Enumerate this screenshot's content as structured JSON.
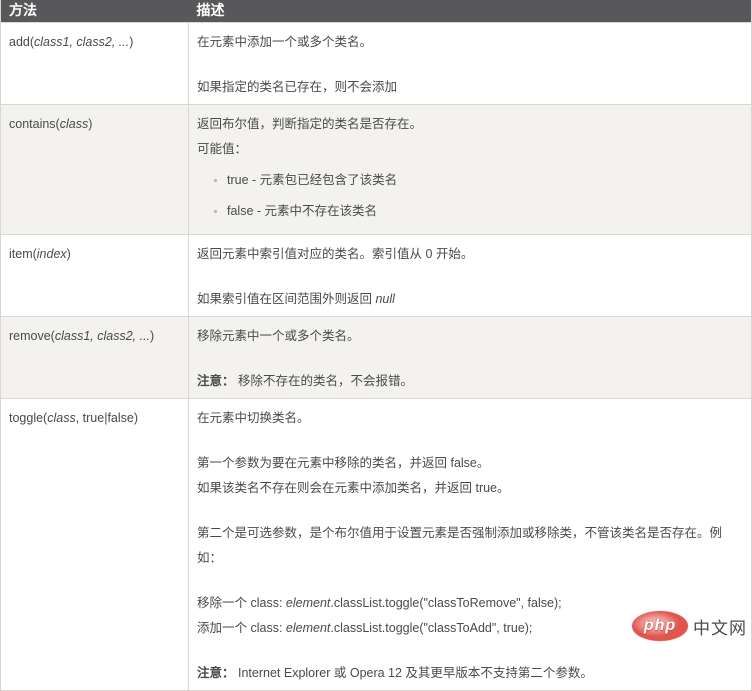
{
  "table": {
    "header_bg": "#58585a",
    "stripe_color": "#f3f2ee",
    "border_color": "#d8d7d3",
    "text_color": "#494a4e",
    "header": {
      "method_label": "方法",
      "description_label": "描述"
    },
    "rows": [
      {
        "method": [
          {
            "t": "add("
          },
          {
            "t": "class1, class2, ...",
            "i": true
          },
          {
            "t": ")"
          }
        ],
        "description": [
          {
            "type": "p",
            "lines": [
              [
                {
                  "t": "在元素中添加一个或多个类名。"
                }
              ]
            ]
          },
          {
            "type": "p",
            "lines": [
              [
                {
                  "t": "如果指定的类名已存在，则不会添加"
                }
              ]
            ]
          }
        ]
      },
      {
        "method": [
          {
            "t": "contains("
          },
          {
            "t": "class",
            "i": true
          },
          {
            "t": ")"
          }
        ],
        "description": [
          {
            "type": "p",
            "lines": [
              [
                {
                  "t": "返回布尔值，判断指定的类名是否存在。"
                }
              ],
              [
                {
                  "t": "可能值："
                }
              ]
            ]
          },
          {
            "type": "ul",
            "items": [
              [
                {
                  "t": "true - 元素包已经包含了该类名"
                }
              ],
              [
                {
                  "t": "false - 元素中不存在该类名"
                }
              ]
            ]
          }
        ]
      },
      {
        "method": [
          {
            "t": "item("
          },
          {
            "t": "index",
            "i": true
          },
          {
            "t": ")"
          }
        ],
        "description": [
          {
            "type": "p",
            "lines": [
              [
                {
                  "t": "返回元素中索引值对应的类名。索引值从 0 开始。"
                }
              ]
            ]
          },
          {
            "type": "p",
            "lines": [
              [
                {
                  "t": "如果索引值在区间范围外则返回 "
                },
                {
                  "t": "null",
                  "i": true
                }
              ]
            ]
          }
        ]
      },
      {
        "method": [
          {
            "t": "remove("
          },
          {
            "t": "class1, class2, ...",
            "i": true
          },
          {
            "t": ")"
          }
        ],
        "description": [
          {
            "type": "p",
            "lines": [
              [
                {
                  "t": "移除元素中一个或多个类名。"
                }
              ]
            ]
          },
          {
            "type": "p",
            "lines": [
              [
                {
                  "t": "注意：",
                  "b": true
                },
                {
                  "t": " 移除不存在的类名，不会报错。"
                }
              ]
            ]
          }
        ]
      },
      {
        "method": [
          {
            "t": "toggle("
          },
          {
            "t": "class",
            "i": true
          },
          {
            "t": ", true|false)"
          }
        ],
        "description": [
          {
            "type": "p",
            "lines": [
              [
                {
                  "t": "在元素中切换类名。"
                }
              ]
            ]
          },
          {
            "type": "p",
            "lines": [
              [
                {
                  "t": "第一个参数为要在元素中移除的类名，并返回 false。"
                }
              ],
              [
                {
                  "t": "如果该类名不存在则会在元素中添加类名，并返回 true。"
                }
              ]
            ]
          },
          {
            "type": "p",
            "lines": [
              [
                {
                  "t": "第二个是可选参数，是个布尔值用于设置元素是否强制添加或移除类，不管该类名是否存在。例如："
                }
              ]
            ]
          },
          {
            "type": "p",
            "lines": [
              [
                {
                  "t": "移除一个 class: "
                },
                {
                  "t": "element",
                  "i": true
                },
                {
                  "t": ".classList.toggle(\"classToRemove\", false);"
                }
              ],
              [
                {
                  "t": "添加一个 class: "
                },
                {
                  "t": "element",
                  "i": true
                },
                {
                  "t": ".classList.toggle(\"classToAdd\", true);"
                }
              ]
            ]
          },
          {
            "type": "p",
            "lines": [
              [
                {
                  "t": "注意：",
                  "b": true
                },
                {
                  "t": " Internet Explorer 或 Opera 12 及其更早版本不支持第二个参数。"
                }
              ]
            ]
          }
        ]
      }
    ]
  },
  "watermark": {
    "logo_text": "php",
    "site_text": "中文网",
    "logo_color": "#e0564e"
  }
}
